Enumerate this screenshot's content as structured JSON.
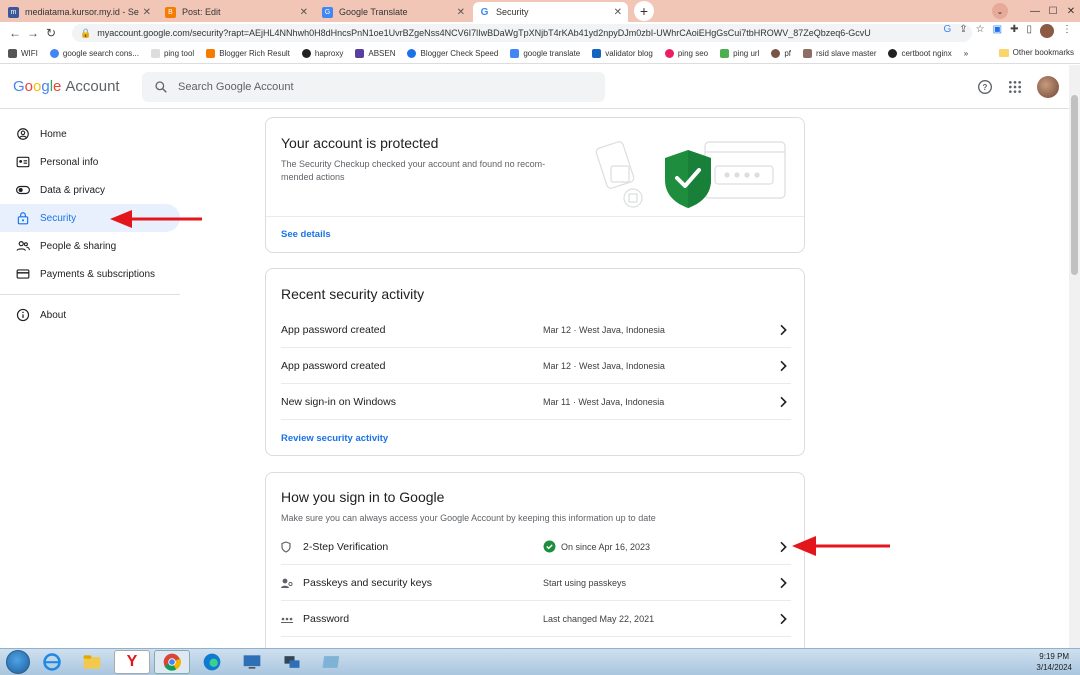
{
  "browser": {
    "tabs": [
      {
        "title": "mediatama.kursor.my.id - Servic",
        "favicon_color": "#3b5998",
        "active": false
      },
      {
        "title": "Post: Edit",
        "favicon_color": "#f57c00",
        "active": false
      },
      {
        "title": "Google Translate",
        "favicon_color": "#4285f4",
        "active": false
      },
      {
        "title": "Security",
        "favicon_color": "#4285f4",
        "active": true
      }
    ],
    "url": "myaccount.google.com/security?rapt=AEjHL4NNhwh0H8dHncsPnN1oe1UvrBZgeNss4NCV6I7lIwBDaWgTpXNjbT4rKAb41yd2npyDJm0zbI-UWhrCAoiEHgGsCui7tbHROWV_87ZeQbzeq6-GcvU",
    "bookmarks": [
      "WIFI",
      "google search cons...",
      "ping tool",
      "Blogger Rich Result",
      "haproxy",
      "ABSEN",
      "Blogger Check Speed",
      "google translate",
      "validator blog",
      "ping seo",
      "ping url",
      "pf",
      "rsid slave master",
      "certboot nginx"
    ],
    "bookmarks_more": "»",
    "other_bookmarks": "Other bookmarks"
  },
  "header": {
    "logo_google": "Google",
    "logo_account": "Account",
    "search_placeholder": "Search Google Account"
  },
  "sidebar": {
    "items": [
      {
        "label": "Home",
        "icon": "home-icon"
      },
      {
        "label": "Personal info",
        "icon": "personal-info-icon"
      },
      {
        "label": "Data & privacy",
        "icon": "toggle-icon"
      },
      {
        "label": "Security",
        "icon": "lock-icon",
        "active": true
      },
      {
        "label": "People & sharing",
        "icon": "people-icon"
      },
      {
        "label": "Payments & subscriptions",
        "icon": "card-icon"
      }
    ],
    "about": "About"
  },
  "protected_card": {
    "title": "Your account is protected",
    "desc": "The Security Checkup checked your account and found no recom-mended actions",
    "link": "See details"
  },
  "activity_card": {
    "title": "Recent security activity",
    "rows": [
      {
        "label": "App password created",
        "detail": "Mar 12 · West Java, Indonesia"
      },
      {
        "label": "App password created",
        "detail": "Mar 12 · West Java, Indonesia"
      },
      {
        "label": "New sign-in on Windows",
        "detail": "Mar 11 · West Java, Indonesia"
      }
    ],
    "link": "Review security activity"
  },
  "signin_card": {
    "title": "How you sign in to Google",
    "subtitle": "Make sure you can always access your Google Account by keeping this information up to date",
    "rows": [
      {
        "label": "2-Step Verification",
        "detail": "On since Apr 16, 2023",
        "icon": "shield-small-icon",
        "status": "on"
      },
      {
        "label": "Passkeys and security keys",
        "detail": "Start using passkeys",
        "icon": "passkey-icon"
      },
      {
        "label": "Password",
        "detail": "Last changed May 22, 2021",
        "icon": "password-dots-icon"
      }
    ]
  },
  "taskbar": {
    "time": "9:19 PM",
    "date": "3/14/2024"
  },
  "colors": {
    "accent": "#1a73e8",
    "success": "#1e8e3e",
    "arrow": "#e3161b",
    "tabstrip": "#f2c6b6"
  }
}
